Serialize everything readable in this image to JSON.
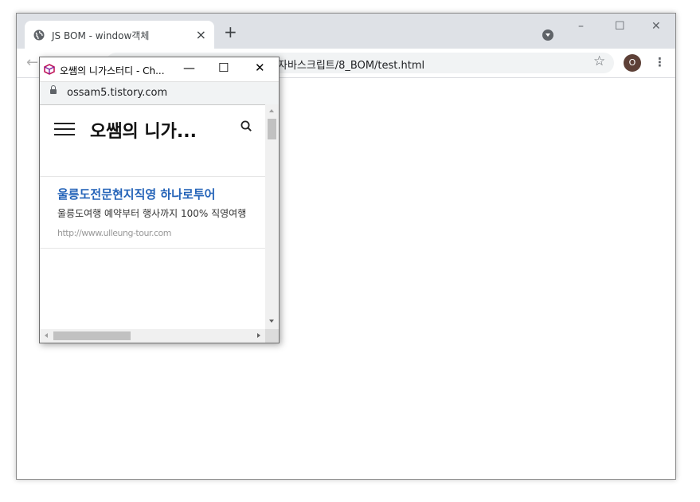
{
  "browser": {
    "tab": {
      "title": "JS BOM - window객체",
      "close_glyph": "×"
    },
    "new_tab_glyph": "+",
    "window_controls": {
      "minimize": "–",
      "maximize": "☐",
      "close": "✕"
    },
    "toolbar": {
      "back_glyph": "←",
      "url": "자바스크립트/8_BOM/test.html",
      "star_glyph": "☆",
      "avatar_letter": "O",
      "menu_glyph": "⋮"
    }
  },
  "popup": {
    "title": "오쌤의 니가스터디 - Ch...",
    "controls": {
      "minimize": "—",
      "maximize": "☐",
      "close": "✕"
    },
    "address": "ossam5.tistory.com",
    "site": {
      "name": "오쌤의 니가..."
    },
    "ad": {
      "title": "울릉도전문현지직영 하나로투어",
      "description": "울릉도여행 예약부터 행사까지 100% 직영여행",
      "url": "http://www.ulleung-tour.com"
    }
  },
  "colors": {
    "tab_strip": "#dee1e6",
    "ad_title": "#2463b8",
    "avatar": "#5d4037"
  }
}
